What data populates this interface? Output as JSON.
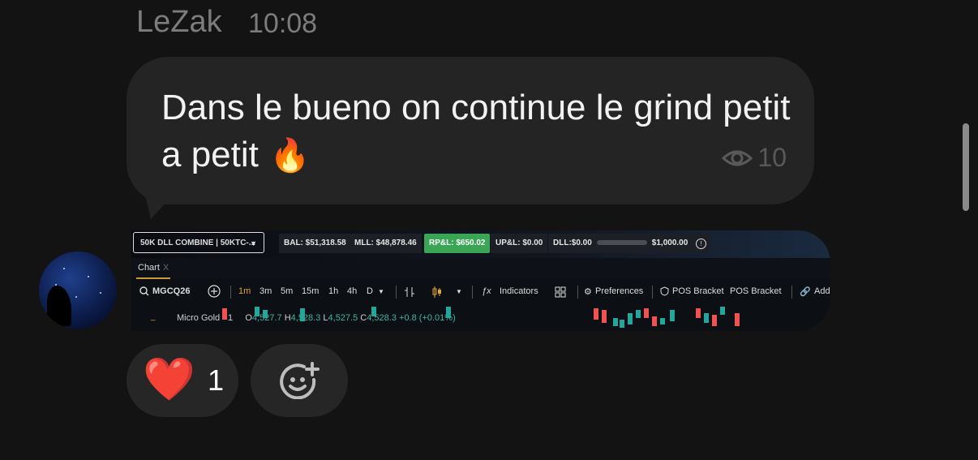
{
  "message": {
    "sender": "LeZak",
    "time": "10:08",
    "text": "Dans le bueno on continue le grind petit a petit",
    "emoji": "🔥",
    "views": "10"
  },
  "screenshot": {
    "account": "50K DLL COMBINE | 50KTC-...",
    "bal": "BAL: $51,318.58",
    "mll": "MLL: $48,878.46",
    "rpl": "RP&L: $650.02",
    "upl": "UP&L: $0.00",
    "dll_left": "DLL:$0.00",
    "dll_right": "$1,000.00",
    "tab": "Chart",
    "tab_close": "X",
    "symbol": "MGCQ26",
    "timeframes": [
      "1m",
      "3m",
      "5m",
      "15m",
      "1h",
      "4h",
      "D"
    ],
    "indicators": "Indicators",
    "preferences": "Preferences",
    "pos_bracket_1": "POS Bracket",
    "pos_bracket_2": "POS Bracket",
    "add": "Add",
    "instrument": "Micro Gold · 1",
    "o_label": "O",
    "o_value": "4,527.7",
    "h_label": "H",
    "h_value": "4,528.3",
    "l_label": "L",
    "l_value": "4,527.5",
    "c_label": "C",
    "c_value": "4,528.3",
    "change": "+0.8 (+0.01%)",
    "up_color": "#26a69a",
    "down_color": "#ef5350"
  },
  "reactions": [
    {
      "emoji": "❤️",
      "count": "1",
      "icon": "heart-icon"
    },
    {
      "icon": "add-reaction-icon"
    }
  ]
}
